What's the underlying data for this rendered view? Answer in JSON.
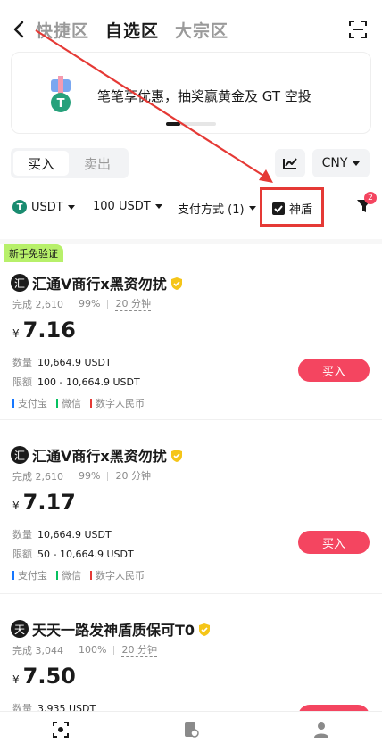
{
  "header": {
    "tabs": [
      {
        "label": "快捷区",
        "active": false
      },
      {
        "label": "自选区",
        "active": true
      },
      {
        "label": "大宗区",
        "active": false
      }
    ]
  },
  "banner": {
    "text": "笔笔享优惠，抽奖赢黄金及 GT 空投"
  },
  "trade_toggle": {
    "buy": "买入",
    "sell": "卖出"
  },
  "currency": "CNY",
  "filters": {
    "coin": "USDT",
    "amount": "100 USDT",
    "payment": "支付方式 (1)",
    "shield": "神盾",
    "filter_badge": "2"
  },
  "labels": {
    "qty": "数量",
    "limit": "限额",
    "buy": "买入",
    "newbie": "新手免验证"
  },
  "merchants": [
    {
      "avatar": "汇",
      "name": "汇通V商行x黑资勿扰",
      "completed": "完成 2,610",
      "rate": "99%",
      "time": "20 分钟",
      "currency_symbol": "¥",
      "price": "7.16",
      "quantity": "10,664.9 USDT",
      "limit": "100 - 10,664.9 USDT",
      "payments": [
        "支付宝",
        "微信",
        "数字人民币"
      ],
      "newbie": true
    },
    {
      "avatar": "汇",
      "name": "汇通V商行x黑资勿扰",
      "completed": "完成 2,610",
      "rate": "99%",
      "time": "20 分钟",
      "currency_symbol": "¥",
      "price": "7.17",
      "quantity": "10,664.9 USDT",
      "limit": "50 - 10,664.9 USDT",
      "payments": [
        "支付宝",
        "微信",
        "数字人民币"
      ],
      "newbie": false
    },
    {
      "avatar": "天",
      "name": "天天一路发神盾质保可T0",
      "completed": "完成 3,044",
      "rate": "100%",
      "time": "20 分钟",
      "currency_symbol": "¥",
      "price": "7.50",
      "quantity": "3,935 USDT",
      "newbie": false
    }
  ],
  "colors": {
    "accent_red": "#f44560",
    "annotation_red": "#e53935",
    "alipay": "#1677ff",
    "wechat": "#07c160",
    "ecny": "#e53935",
    "newbie_green": "#b7f06a"
  },
  "icons": {
    "back": "chevron-left-icon",
    "scan": "scan-icon",
    "chart": "chart-icon",
    "filter": "funnel-icon"
  }
}
